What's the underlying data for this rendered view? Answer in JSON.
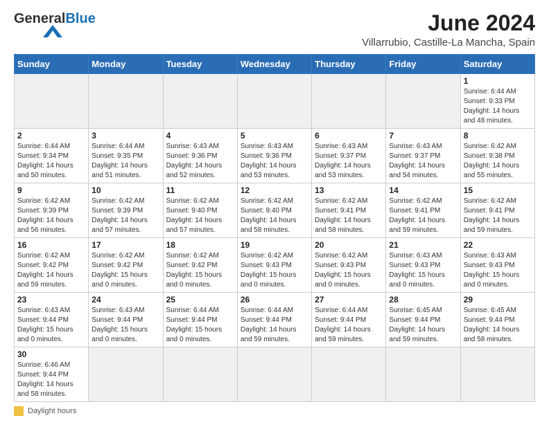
{
  "logo": {
    "general": "General",
    "blue": "Blue"
  },
  "title": "June 2024",
  "subtitle": "Villarrubio, Castille-La Mancha, Spain",
  "days_of_week": [
    "Sunday",
    "Monday",
    "Tuesday",
    "Wednesday",
    "Thursday",
    "Friday",
    "Saturday"
  ],
  "footer": {
    "daylight_label": "Daylight hours"
  },
  "weeks": [
    {
      "days": [
        {
          "num": "",
          "info": ""
        },
        {
          "num": "",
          "info": ""
        },
        {
          "num": "",
          "info": ""
        },
        {
          "num": "",
          "info": ""
        },
        {
          "num": "",
          "info": ""
        },
        {
          "num": "",
          "info": ""
        },
        {
          "num": "1",
          "info": "Sunrise: 6:44 AM\nSunset: 9:33 PM\nDaylight: 14 hours\nand 48 minutes."
        }
      ]
    },
    {
      "days": [
        {
          "num": "2",
          "info": "Sunrise: 6:44 AM\nSunset: 9:34 PM\nDaylight: 14 hours\nand 50 minutes."
        },
        {
          "num": "3",
          "info": "Sunrise: 6:44 AM\nSunset: 9:35 PM\nDaylight: 14 hours\nand 51 minutes."
        },
        {
          "num": "4",
          "info": "Sunrise: 6:43 AM\nSunset: 9:36 PM\nDaylight: 14 hours\nand 52 minutes."
        },
        {
          "num": "5",
          "info": "Sunrise: 6:43 AM\nSunset: 9:36 PM\nDaylight: 14 hours\nand 53 minutes."
        },
        {
          "num": "6",
          "info": "Sunrise: 6:43 AM\nSunset: 9:37 PM\nDaylight: 14 hours\nand 53 minutes."
        },
        {
          "num": "7",
          "info": "Sunrise: 6:43 AM\nSunset: 9:37 PM\nDaylight: 14 hours\nand 54 minutes."
        },
        {
          "num": "8",
          "info": "Sunrise: 6:42 AM\nSunset: 9:38 PM\nDaylight: 14 hours\nand 55 minutes."
        }
      ]
    },
    {
      "days": [
        {
          "num": "9",
          "info": "Sunrise: 6:42 AM\nSunset: 9:39 PM\nDaylight: 14 hours\nand 56 minutes."
        },
        {
          "num": "10",
          "info": "Sunrise: 6:42 AM\nSunset: 9:39 PM\nDaylight: 14 hours\nand 57 minutes."
        },
        {
          "num": "11",
          "info": "Sunrise: 6:42 AM\nSunset: 9:40 PM\nDaylight: 14 hours\nand 57 minutes."
        },
        {
          "num": "12",
          "info": "Sunrise: 6:42 AM\nSunset: 9:40 PM\nDaylight: 14 hours\nand 58 minutes."
        },
        {
          "num": "13",
          "info": "Sunrise: 6:42 AM\nSunset: 9:41 PM\nDaylight: 14 hours\nand 58 minutes."
        },
        {
          "num": "14",
          "info": "Sunrise: 6:42 AM\nSunset: 9:41 PM\nDaylight: 14 hours\nand 59 minutes."
        },
        {
          "num": "15",
          "info": "Sunrise: 6:42 AM\nSunset: 9:41 PM\nDaylight: 14 hours\nand 59 minutes."
        }
      ]
    },
    {
      "days": [
        {
          "num": "16",
          "info": "Sunrise: 6:42 AM\nSunset: 9:42 PM\nDaylight: 14 hours\nand 59 minutes."
        },
        {
          "num": "17",
          "info": "Sunrise: 6:42 AM\nSunset: 9:42 PM\nDaylight: 15 hours\nand 0 minutes."
        },
        {
          "num": "18",
          "info": "Sunrise: 6:42 AM\nSunset: 9:42 PM\nDaylight: 15 hours\nand 0 minutes."
        },
        {
          "num": "19",
          "info": "Sunrise: 6:42 AM\nSunset: 9:43 PM\nDaylight: 15 hours\nand 0 minutes."
        },
        {
          "num": "20",
          "info": "Sunrise: 6:42 AM\nSunset: 9:43 PM\nDaylight: 15 hours\nand 0 minutes."
        },
        {
          "num": "21",
          "info": "Sunrise: 6:43 AM\nSunset: 9:43 PM\nDaylight: 15 hours\nand 0 minutes."
        },
        {
          "num": "22",
          "info": "Sunrise: 6:43 AM\nSunset: 9:43 PM\nDaylight: 15 hours\nand 0 minutes."
        }
      ]
    },
    {
      "days": [
        {
          "num": "23",
          "info": "Sunrise: 6:43 AM\nSunset: 9:44 PM\nDaylight: 15 hours\nand 0 minutes."
        },
        {
          "num": "24",
          "info": "Sunrise: 6:43 AM\nSunset: 9:44 PM\nDaylight: 15 hours\nand 0 minutes."
        },
        {
          "num": "25",
          "info": "Sunrise: 6:44 AM\nSunset: 9:44 PM\nDaylight: 15 hours\nand 0 minutes."
        },
        {
          "num": "26",
          "info": "Sunrise: 6:44 AM\nSunset: 9:44 PM\nDaylight: 14 hours\nand 59 minutes."
        },
        {
          "num": "27",
          "info": "Sunrise: 6:44 AM\nSunset: 9:44 PM\nDaylight: 14 hours\nand 59 minutes."
        },
        {
          "num": "28",
          "info": "Sunrise: 6:45 AM\nSunset: 9:44 PM\nDaylight: 14 hours\nand 59 minutes."
        },
        {
          "num": "29",
          "info": "Sunrise: 6:45 AM\nSunset: 9:44 PM\nDaylight: 14 hours\nand 58 minutes."
        }
      ]
    },
    {
      "days": [
        {
          "num": "30",
          "info": "Sunrise: 6:46 AM\nSunset: 9:44 PM\nDaylight: 14 hours\nand 58 minutes."
        },
        {
          "num": "",
          "info": ""
        },
        {
          "num": "",
          "info": ""
        },
        {
          "num": "",
          "info": ""
        },
        {
          "num": "",
          "info": ""
        },
        {
          "num": "",
          "info": ""
        },
        {
          "num": "",
          "info": ""
        }
      ]
    }
  ]
}
